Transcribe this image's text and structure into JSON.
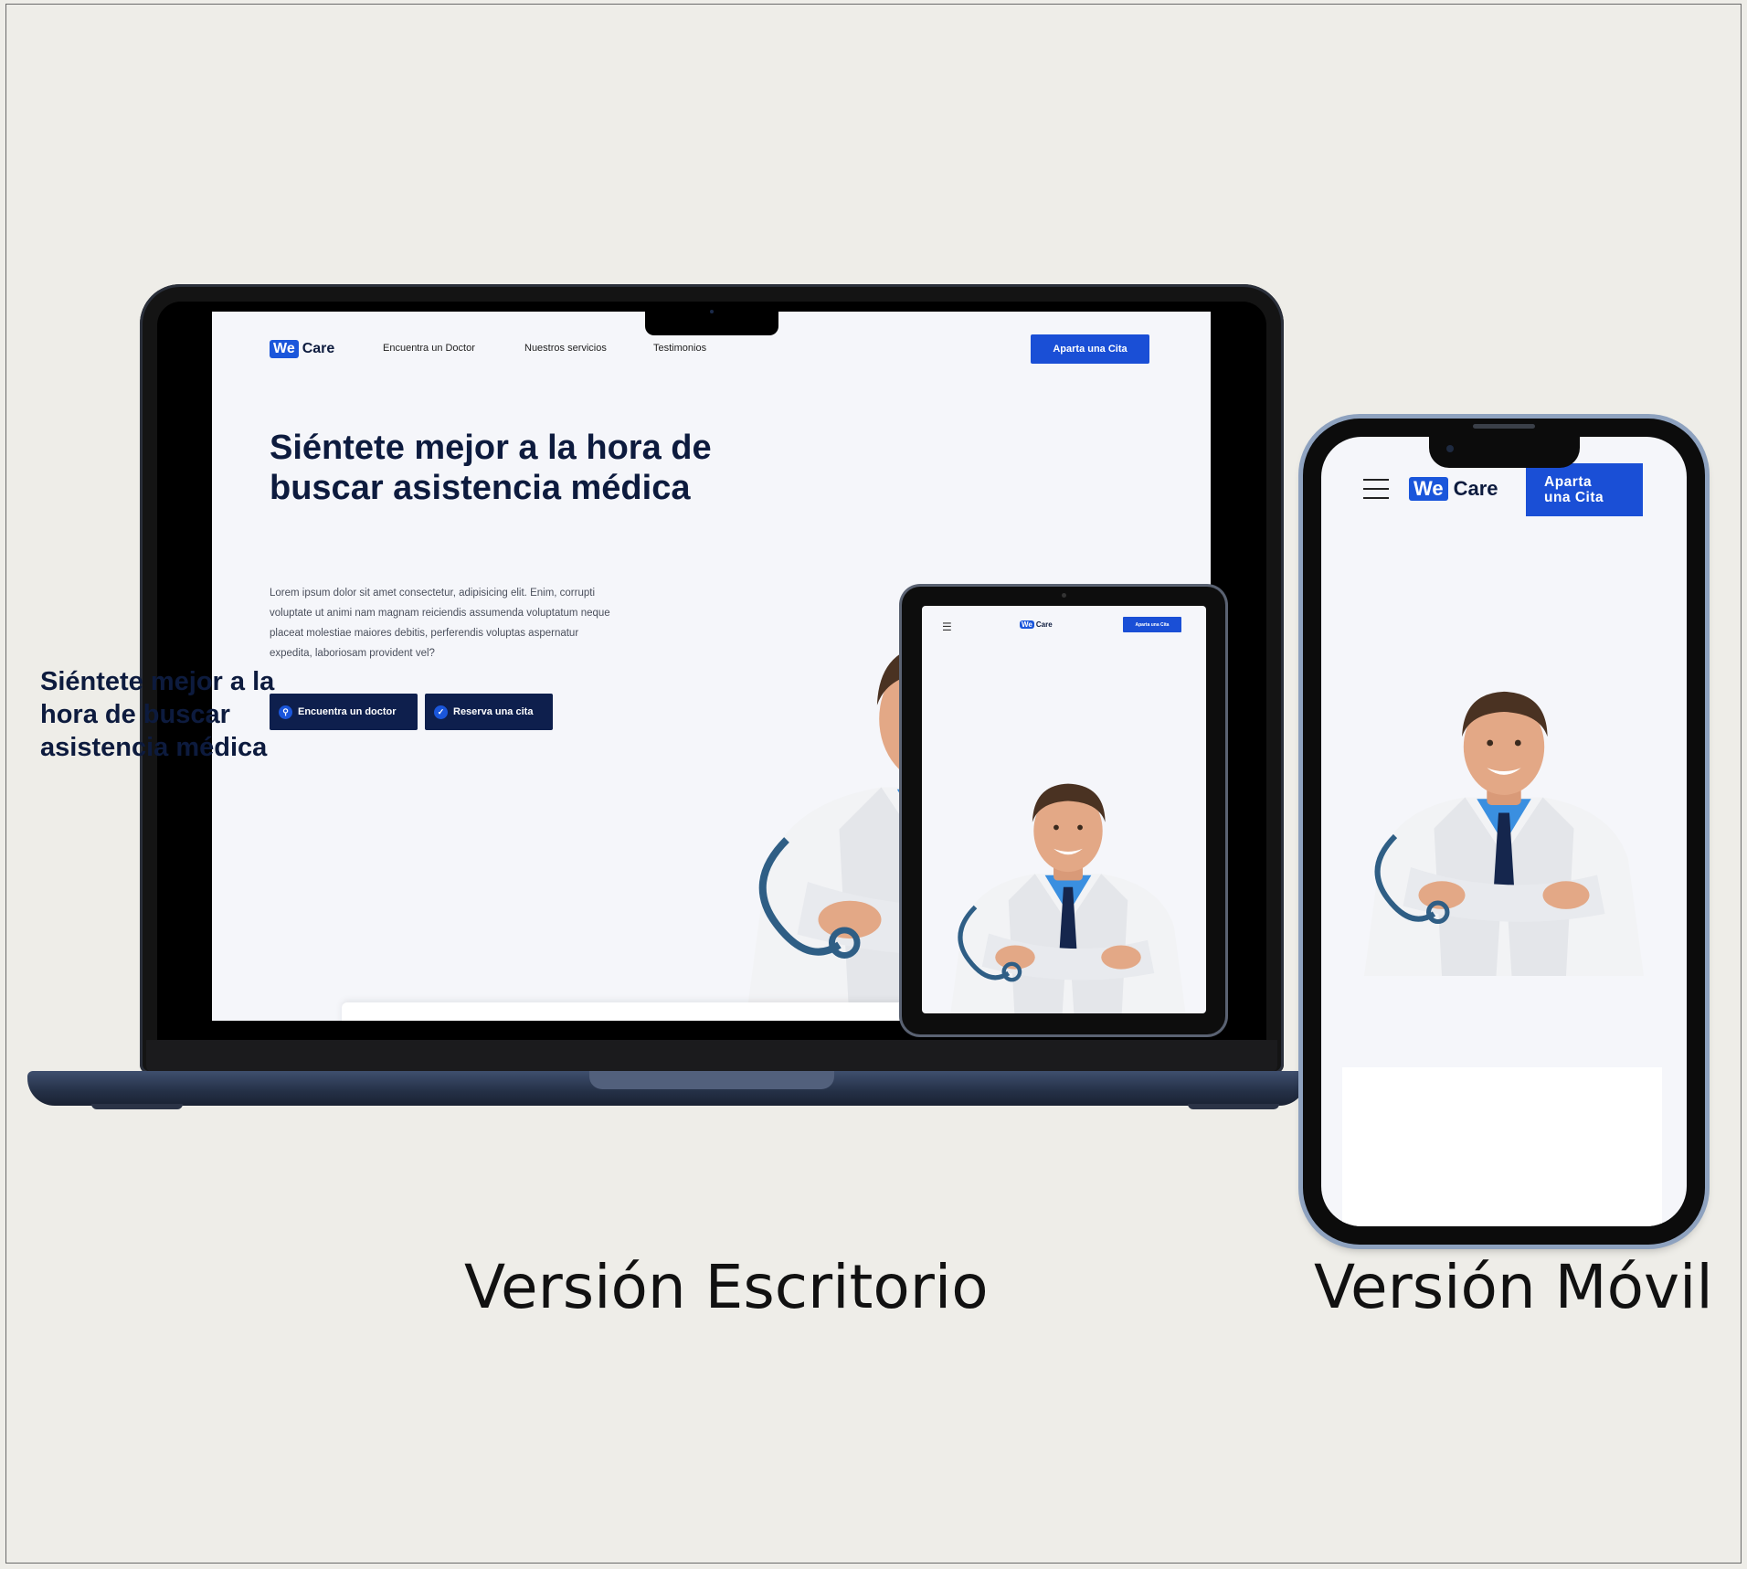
{
  "brand": {
    "we": "We",
    "care": "Care"
  },
  "desktop": {
    "nav": [
      "Encuentra un Doctor",
      "Nuestros servicios",
      "Testimonios"
    ],
    "cta": "Aparta una Cita",
    "headline": "Siéntete mejor a la hora de buscar asistencia médica",
    "paragraph": "Lorem ipsum dolor sit amet consectetur, adipisicing elit. Enim, corrupti voluptate ut animi nam magnam reiciendis assumenda voluptatum neque placeat molestiae maiores debitis, perferendis voluptas aspernatur expedita, laboriosam provident vel?",
    "btn_find": "Encuentra un doctor",
    "btn_book": "Reserva una cita"
  },
  "tablet": {
    "cta": "Aparta una Cita"
  },
  "mobile": {
    "cta_line1": "Aparta",
    "cta_line2": "una Cita",
    "headline": "Siéntete mejor a la hora de buscar asistencia médica"
  },
  "captions": {
    "desktop": "Versión Escritorio",
    "mobile": "Versión Móvil"
  },
  "icons": {
    "menu": "hamburger-menu-icon",
    "search": "search-icon",
    "check": "check-icon"
  },
  "colors": {
    "primary": "#1a4fd6",
    "navy": "#0e1f4d",
    "headline": "#0d1b3e",
    "background": "#eeede8"
  }
}
